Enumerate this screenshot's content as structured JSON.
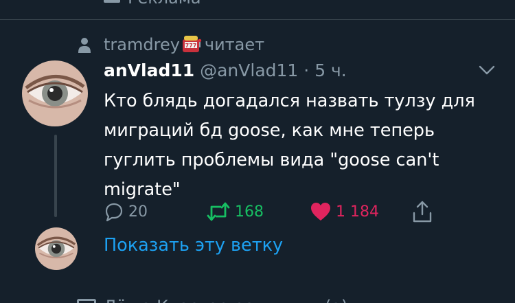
{
  "top_strip": {
    "label": "Реклама"
  },
  "context": {
    "user": "tramdrey",
    "emoji": "slot-machine-icon",
    "action": "читает"
  },
  "tweet": {
    "display_name": "anVlad11",
    "handle": "@anVlad11",
    "separator": "·",
    "time": "5 ч.",
    "text": "Кто блядь догадался назвать тулзу для миграций бд goose, как мне теперь гуглить проблемы вида \"goose can't migrate\"",
    "stats": {
      "replies": "20",
      "retweets": "168",
      "likes": "1 184"
    }
  },
  "thread": {
    "show_label": "Показать эту ветку"
  },
  "bottom_strip": {
    "label": "Лёша Кластер ретвитнул(а)"
  },
  "colors": {
    "background": "#15202b",
    "muted": "#8899a6",
    "link": "#1da1f2",
    "retweet": "#17bf63",
    "like": "#e0245e",
    "divider": "#38444d"
  }
}
